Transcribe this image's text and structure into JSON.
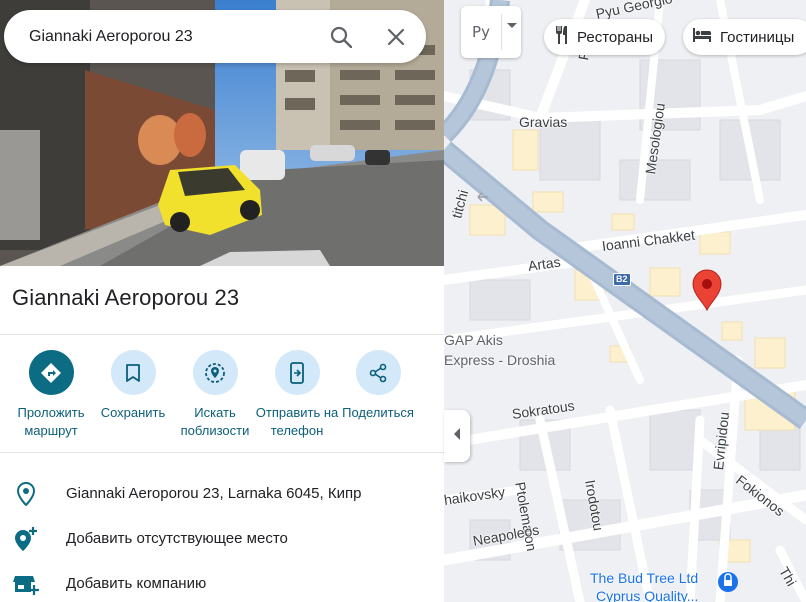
{
  "search": {
    "value": "Giannaki Aeroporou 23",
    "search_icon": "search-icon",
    "close_icon": "close-icon"
  },
  "place": {
    "title": "Giannaki Aeroporou 23"
  },
  "actions": [
    {
      "label": "Проложить маршрут",
      "icon": "directions-icon"
    },
    {
      "label": "Сохранить",
      "icon": "bookmark-icon"
    },
    {
      "label": "Искать поблизости",
      "icon": "nearby-icon"
    },
    {
      "label": "Отправить на телефон",
      "icon": "send-to-phone-icon"
    },
    {
      "label": "Поделиться",
      "icon": "share-icon"
    }
  ],
  "info": [
    {
      "text": "Giannaki Aeroporou 23, Larnaka 6045, Кипр",
      "icon": "location-pin-icon"
    },
    {
      "text": "Добавить отсутствующее место",
      "icon": "add-place-icon"
    },
    {
      "text": "Добавить компанию",
      "icon": "add-business-icon"
    }
  ],
  "map": {
    "layer_label": "Ру",
    "chips": [
      {
        "label": "Рестораны",
        "icon": "restaurant-icon"
      },
      {
        "label": "Гостиницы",
        "icon": "hotel-icon"
      }
    ],
    "streets": [
      "Gravias",
      "Mesologiou",
      "Ioanni Chakket",
      "Artas",
      "Sokratous",
      "Ptolemaion",
      "Irodotou",
      "Evripidou",
      "Fokionos",
      "Neapoleos",
      "haikovsky",
      "Thi",
      "titchi",
      "Pyu Georgio",
      "P"
    ],
    "route_badge": "B2",
    "pois": [
      "GAP Akis",
      "Express - Droshia",
      "The Bud Tree Ltd",
      "Cyprus Quality..."
    ],
    "colors": {
      "main_road": "#a6bad1",
      "pin": "#ea4335",
      "primary_action": "#0b6c84",
      "action_bg": "#d3e8f9",
      "link_text": "#0b5f7a"
    }
  }
}
